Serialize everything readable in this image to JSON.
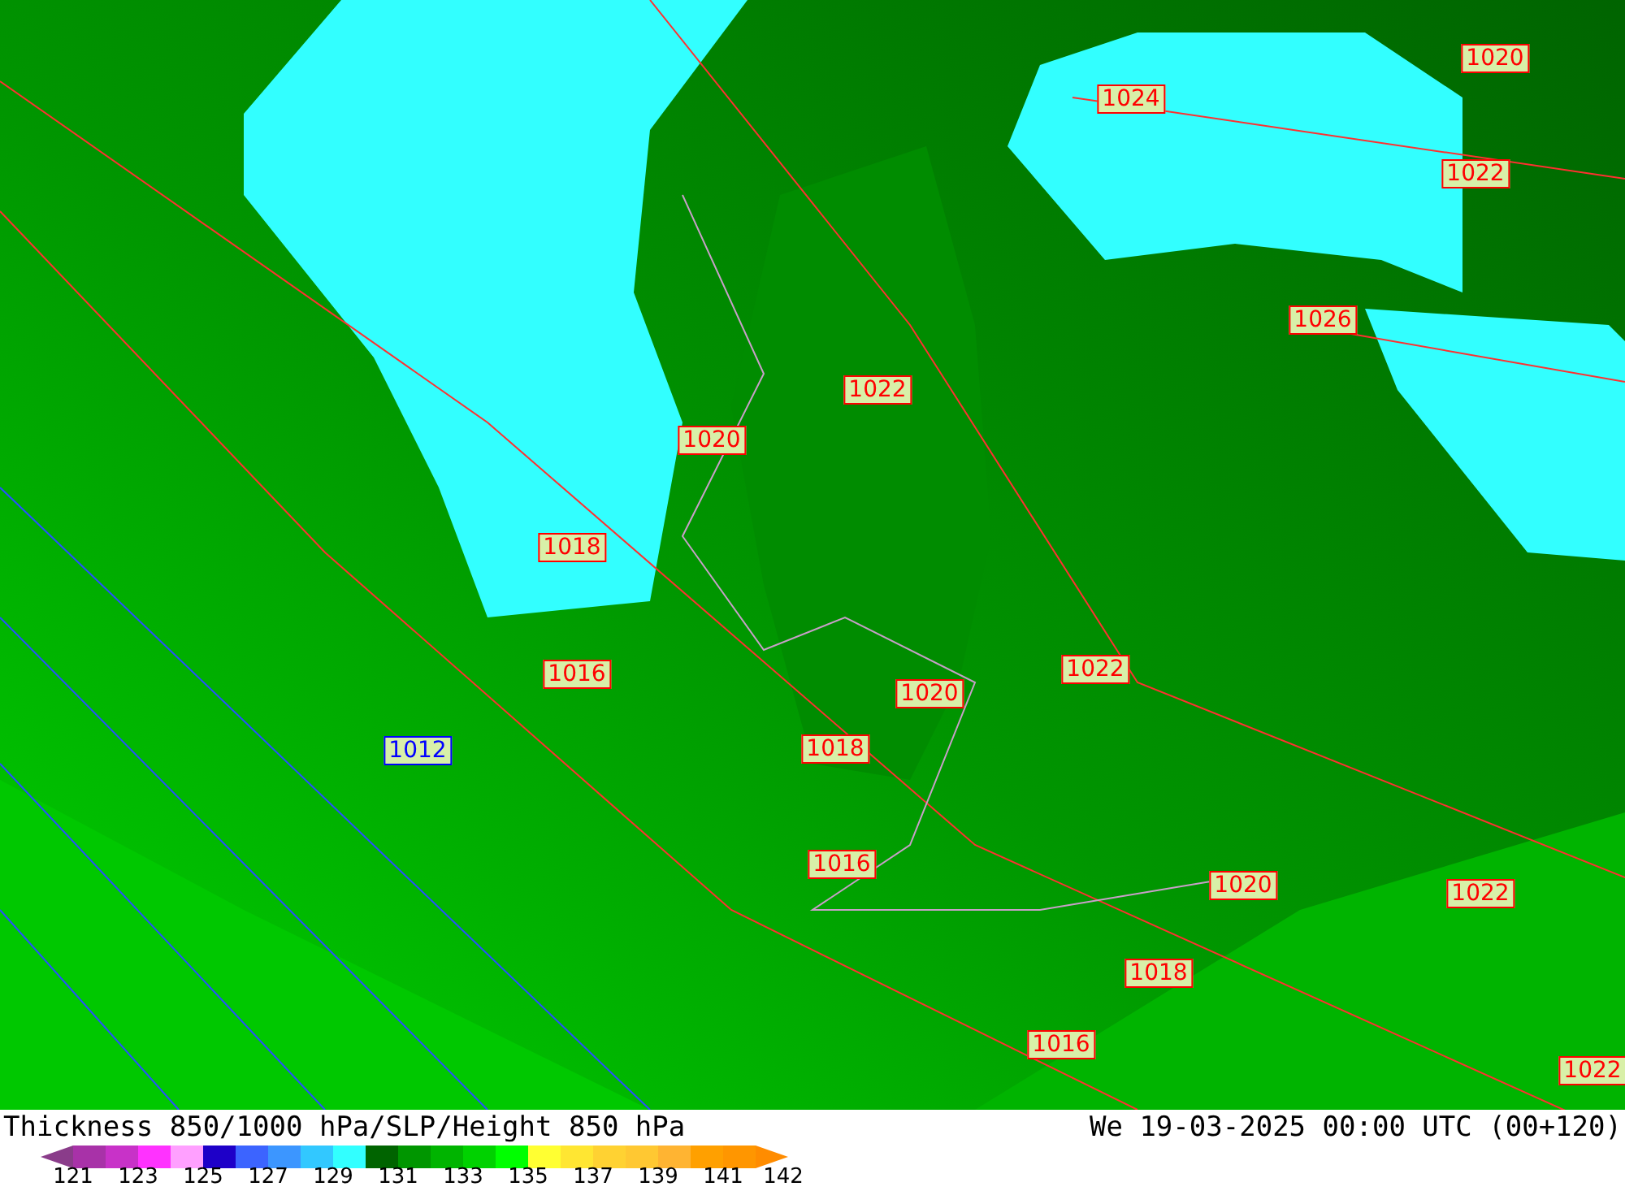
{
  "map": {
    "isobar_labels": [
      {
        "text": "1020",
        "color": "#ff0000"
      },
      {
        "text": "1024",
        "color": "#ff0000"
      },
      {
        "text": "1022",
        "color": "#ff0000"
      },
      {
        "text": "1026",
        "color": "#ff0000"
      },
      {
        "text": "1022",
        "color": "#ff0000"
      },
      {
        "text": "1020",
        "color": "#ff0000"
      },
      {
        "text": "1018",
        "color": "#ff0000"
      },
      {
        "text": "1016",
        "color": "#ff0000"
      },
      {
        "text": "1022",
        "color": "#ff0000"
      },
      {
        "text": "1020",
        "color": "#ff0000"
      },
      {
        "text": "1012",
        "color": "#0000ff"
      },
      {
        "text": "1018",
        "color": "#ff0000"
      },
      {
        "text": "1016",
        "color": "#ff0000"
      },
      {
        "text": "1020",
        "color": "#ff0000"
      },
      {
        "text": "1022",
        "color": "#ff0000"
      },
      {
        "text": "1018",
        "color": "#ff0000"
      },
      {
        "text": "1016",
        "color": "#ff0000"
      },
      {
        "text": "1022",
        "color": "#ff0000"
      }
    ]
  },
  "footer": {
    "title": "Thickness 850/1000 hPa/SLP/Height 850 hPa",
    "valid_time": "We 19-03-2025 00:00 UTC (00+120)",
    "legend_ticks": [
      "121",
      "123",
      "125",
      "127",
      "129",
      "131",
      "133",
      "135",
      "137",
      "139",
      "141",
      "142"
    ]
  }
}
